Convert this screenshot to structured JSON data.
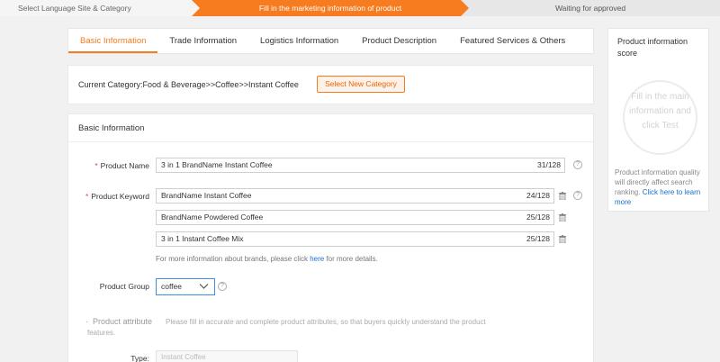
{
  "steps": {
    "step1": "Select Language Site & Category",
    "step2": "Fill in the marketing information of product",
    "step3": "Waiting for approved"
  },
  "tabs": [
    {
      "label": "Basic Information"
    },
    {
      "label": "Trade Information"
    },
    {
      "label": "Logistics Information"
    },
    {
      "label": "Product Description"
    },
    {
      "label": "Featured Services & Others"
    }
  ],
  "category": {
    "text": "Current Category:Food & Beverage>>Coffee>>Instant Coffee",
    "button": "Select New Category"
  },
  "basic": {
    "title": "Basic Information",
    "product_name_label": "Product Name",
    "product_name_value": "3 in 1 BrandName Instant Coffee",
    "product_name_count": "31/128",
    "keyword_label": "Product Keyword",
    "keywords": [
      {
        "value": "BrandName Instant Coffee",
        "count": "24/128"
      },
      {
        "value": "BrandName Powdered Coffee",
        "count": "25/128"
      },
      {
        "value": "3 in 1 Instant Coffee Mix",
        "count": "25/128"
      }
    ],
    "note_prefix": "For more information about brands, please click ",
    "note_link": "here",
    "note_suffix": " for more details.",
    "group_label": "Product Group",
    "group_value": "coffee",
    "attr_heading": "Product attribute",
    "attr_desc_line1": "Please fill in accurate and complete product attributes, so that buyers quickly understand the product",
    "attr_desc_line2": "features.",
    "type_label": "Type:",
    "type_value": "Instant Coffee"
  },
  "score": {
    "title_line1": "Product information",
    "title_line2": "score",
    "circle_line1": "Fill in the main",
    "circle_line2": "information and",
    "circle_line3": "click Test",
    "desc_text": "Product information quality will directly affect search ranking.",
    "desc_link": "Click here to learn more"
  },
  "colors": {
    "accent": "#f77b1f",
    "link": "#1a6fd0",
    "required": "#e5453a"
  }
}
